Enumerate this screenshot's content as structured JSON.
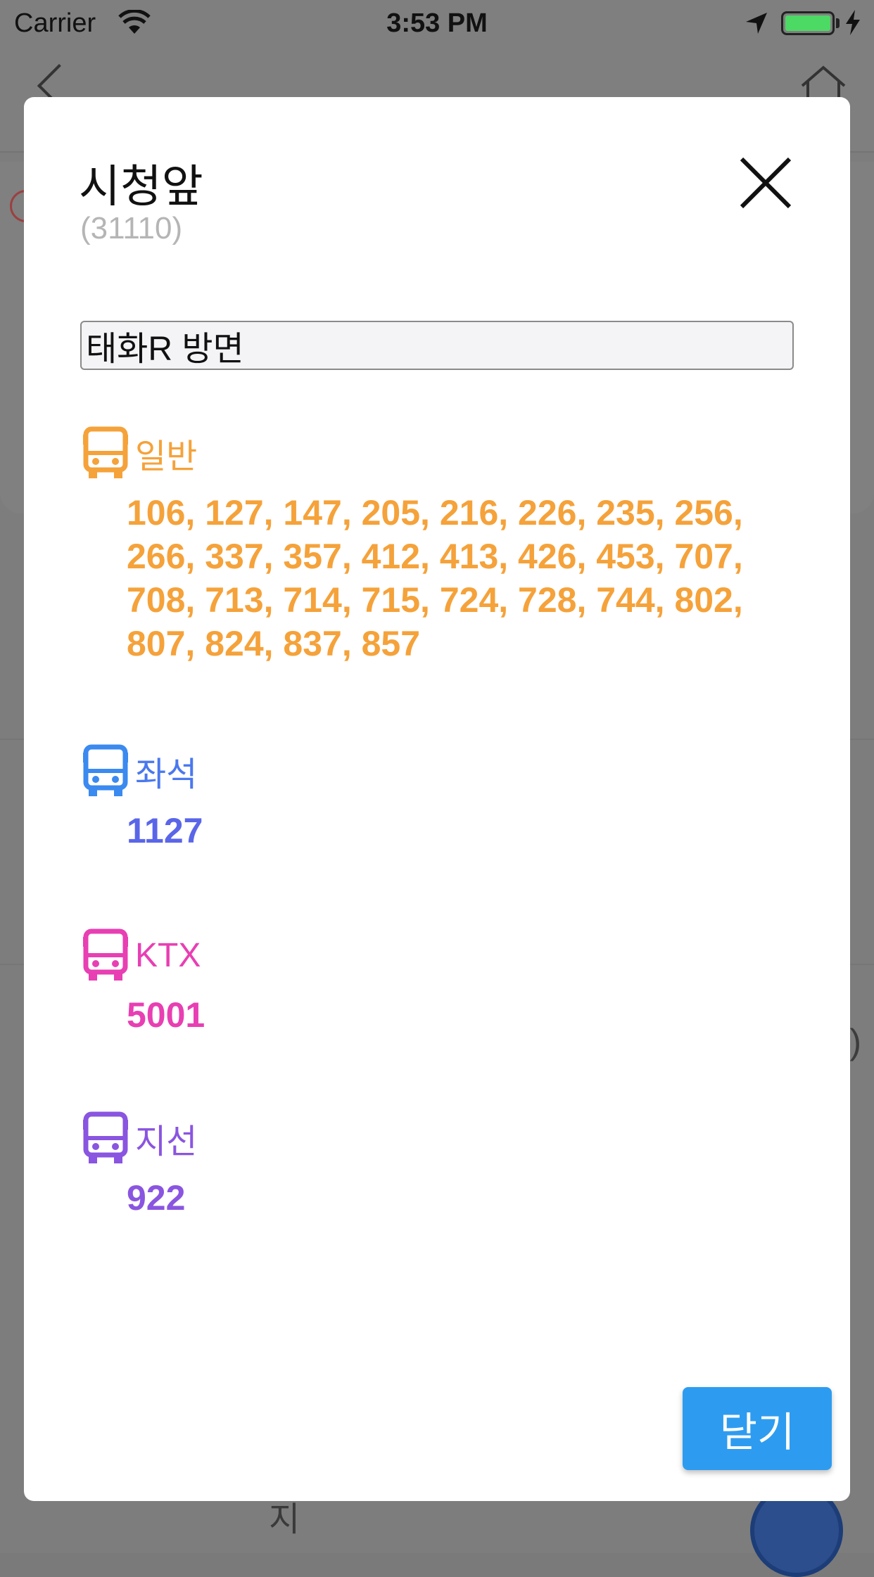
{
  "status_bar": {
    "carrier": "Carrier",
    "time": "3:53 PM"
  },
  "background": {
    "bottom_text": "지",
    "right_text": ")"
  },
  "modal": {
    "title": "시청앞",
    "subtitle": "(31110)",
    "direction_value": "태화R 방면",
    "groups": [
      {
        "label": "일반",
        "color": "#f5a23a",
        "routes": "106, 127, 147, 205, 216, 226, 235, 256, 266, 337, 357, 412, 413, 426, 453, 707, 708, 713, 714, 715, 724, 728, 744, 802, 807, 824, 837, 857"
      },
      {
        "label": "좌석",
        "color": "#4a8cf0",
        "routes": "1127"
      },
      {
        "label": "KTX",
        "color": "#e83fb3",
        "routes": "5001"
      },
      {
        "label": "지선",
        "color": "#8a55e0",
        "routes": "922"
      }
    ],
    "close_label": "닫기"
  }
}
